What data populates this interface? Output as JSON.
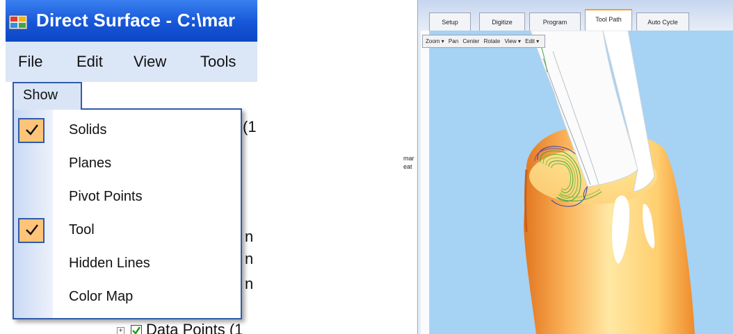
{
  "left_window": {
    "title": "Direct Surface - C:\\mar",
    "menubar": [
      "File",
      "Edit",
      "View",
      "Tools"
    ],
    "show_label": "Show",
    "tree_fragments": [
      "(1",
      "n",
      "n",
      "n",
      "Data Points (1"
    ],
    "menu_items": [
      {
        "label": "Solids",
        "checked": true
      },
      {
        "label": "Planes",
        "checked": false
      },
      {
        "label": "Pivot Points",
        "checked": false
      },
      {
        "label": "Tool",
        "checked": true
      },
      {
        "label": "Hidden Lines",
        "checked": false
      },
      {
        "label": "Color Map",
        "checked": false
      }
    ]
  },
  "right_window": {
    "side_text": [
      "mar",
      "eat"
    ],
    "tabs": [
      {
        "label": "Setup",
        "active": false
      },
      {
        "label": "Digitize",
        "active": false
      },
      {
        "label": "Program",
        "active": false
      },
      {
        "label": "Tool Path",
        "active": true
      },
      {
        "label": "Auto Cycle",
        "active": false
      }
    ],
    "toolbar": [
      "Zoom ▾",
      "Pan",
      "Center",
      "Rotate",
      "View ▾",
      "Edit ▾"
    ]
  },
  "colors": {
    "title_blue": "#1656d8",
    "menu_border": "#315aa8",
    "check_fill": "#ffc47a",
    "viewport_sky": "#a6d2f3",
    "part_orange": "#f08a2e"
  }
}
